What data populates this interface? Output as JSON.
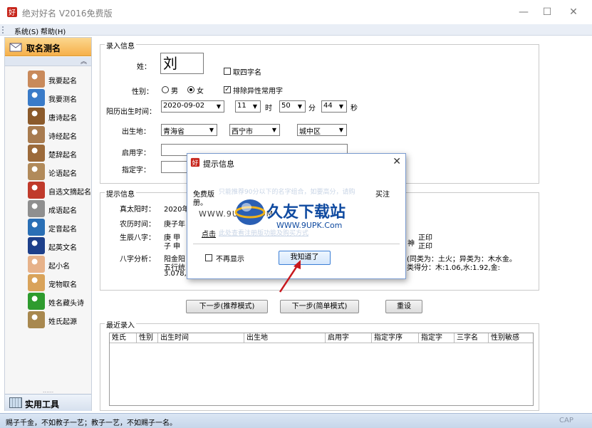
{
  "window": {
    "title": "绝对好名 V2016免费版",
    "min": "—",
    "max": "☐",
    "close": "✕"
  },
  "menu": [
    "系统(S)",
    "帮助(H)"
  ],
  "nav": {
    "header": "取名测名",
    "collapse": "︽",
    "items": [
      {
        "label": "我要起名",
        "icon": "person-icon",
        "color": "#c98a5b"
      },
      {
        "label": "我要测名",
        "icon": "magnifier-icon",
        "color": "#3a7bc8"
      },
      {
        "label": "唐诗起名",
        "icon": "tang-poem-icon",
        "color": "#8b5a2b"
      },
      {
        "label": "诗经起名",
        "icon": "book-of-songs-icon",
        "color": "#a87b4f"
      },
      {
        "label": "楚辞起名",
        "icon": "chuci-icon",
        "color": "#9c6a3a"
      },
      {
        "label": "论语起名",
        "icon": "analects-icon",
        "color": "#b18a5a"
      },
      {
        "label": "自选文摘起名",
        "icon": "books-icon",
        "color": "#c03a2b"
      },
      {
        "label": "成语起名",
        "icon": "idiom-icon",
        "color": "#8f8f8f"
      },
      {
        "label": "定音起名",
        "icon": "globe-icon",
        "color": "#2a6fb5"
      },
      {
        "label": "起英文名",
        "icon": "uk-flag-icon",
        "color": "#1d3f8a"
      },
      {
        "label": "起小名",
        "icon": "baby-icon",
        "color": "#e7b28a"
      },
      {
        "label": "宠物取名",
        "icon": "dog-icon",
        "color": "#d9a35a"
      },
      {
        "label": "姓名藏头诗",
        "icon": "poem-character-icon",
        "color": "#2e9b2e"
      },
      {
        "label": "姓氏起源",
        "icon": "scroll-icon",
        "color": "#a8884f"
      }
    ],
    "grip": "......",
    "footer": "实用工具"
  },
  "entry": {
    "group_title": "录入信息",
    "surname_label": "姓：",
    "surname_value": "刘",
    "four_char_label": "取四字名",
    "gender_label": "性别：",
    "male": "男",
    "female": "女",
    "exclude_label": "排除异性常用字",
    "birth_label": "阳历出生时间：",
    "date": "2020-09-02",
    "hour": "11",
    "hour_unit": "时",
    "minute": "50",
    "minute_unit": "分",
    "second": "44",
    "second_unit": "秒",
    "birthplace_label": "出生地：",
    "province": "青海省",
    "city": "西宁市",
    "district": "城中区",
    "used_char_label": "启用字：",
    "designated_label": "指定字："
  },
  "hint": {
    "group_title": "提示信息",
    "solar_label": "真太阳时：",
    "solar_value": "2020年",
    "lunar_label": "农历时间：",
    "lunar_value": "庚子年",
    "bazi_label": "生辰八字：",
    "bazi_line1": "庚  甲",
    "bazi_line2": "子  申",
    "bazi_right1": "正印",
    "bazi_right2": "正印",
    "bazi_god": "神",
    "analysis_label": "八字分析：",
    "analysis_line1": "阳金阳",
    "analysis_line2": "五行统",
    "analysis_line3": "3.078,",
    "analysis_right1": "(同类为：土火；异类为：木水金。",
    "analysis_right2": "类得分：木:1.06,水:1.92,金:"
  },
  "buttons": {
    "next_recommend": "下一步(推荐模式)",
    "next_simple": "下一步(简单模式)",
    "reset": "重设"
  },
  "recent": {
    "group_title": "最近录入",
    "columns": [
      "姓氏",
      "性别",
      "出生时间",
      "出生地",
      "启用字",
      "指定字序",
      "指定字",
      "三字名",
      "性别敏感"
    ]
  },
  "dialog": {
    "title": "提示信息",
    "close": "✕",
    "msg_line1": "免费版",
    "msg_faded": "只能推荐90分以下的名字组合，如要高分，请购",
    "msg_tail": "买注",
    "msg_line2": "册。",
    "watermark_url_top": "WWW.9UPK.COM",
    "watermark_brand": "久友下载站",
    "watermark_url": "WWW.9UPK.Com",
    "link_label": "点击",
    "link_faded": "此处查看注册版功能及购买方式",
    "dont_show": "不再显示",
    "ok": "我知道了"
  },
  "status": {
    "text": "赐子千金，不如教子一艺；教子一艺，不如赐子一名。",
    "cap": "CAP"
  }
}
